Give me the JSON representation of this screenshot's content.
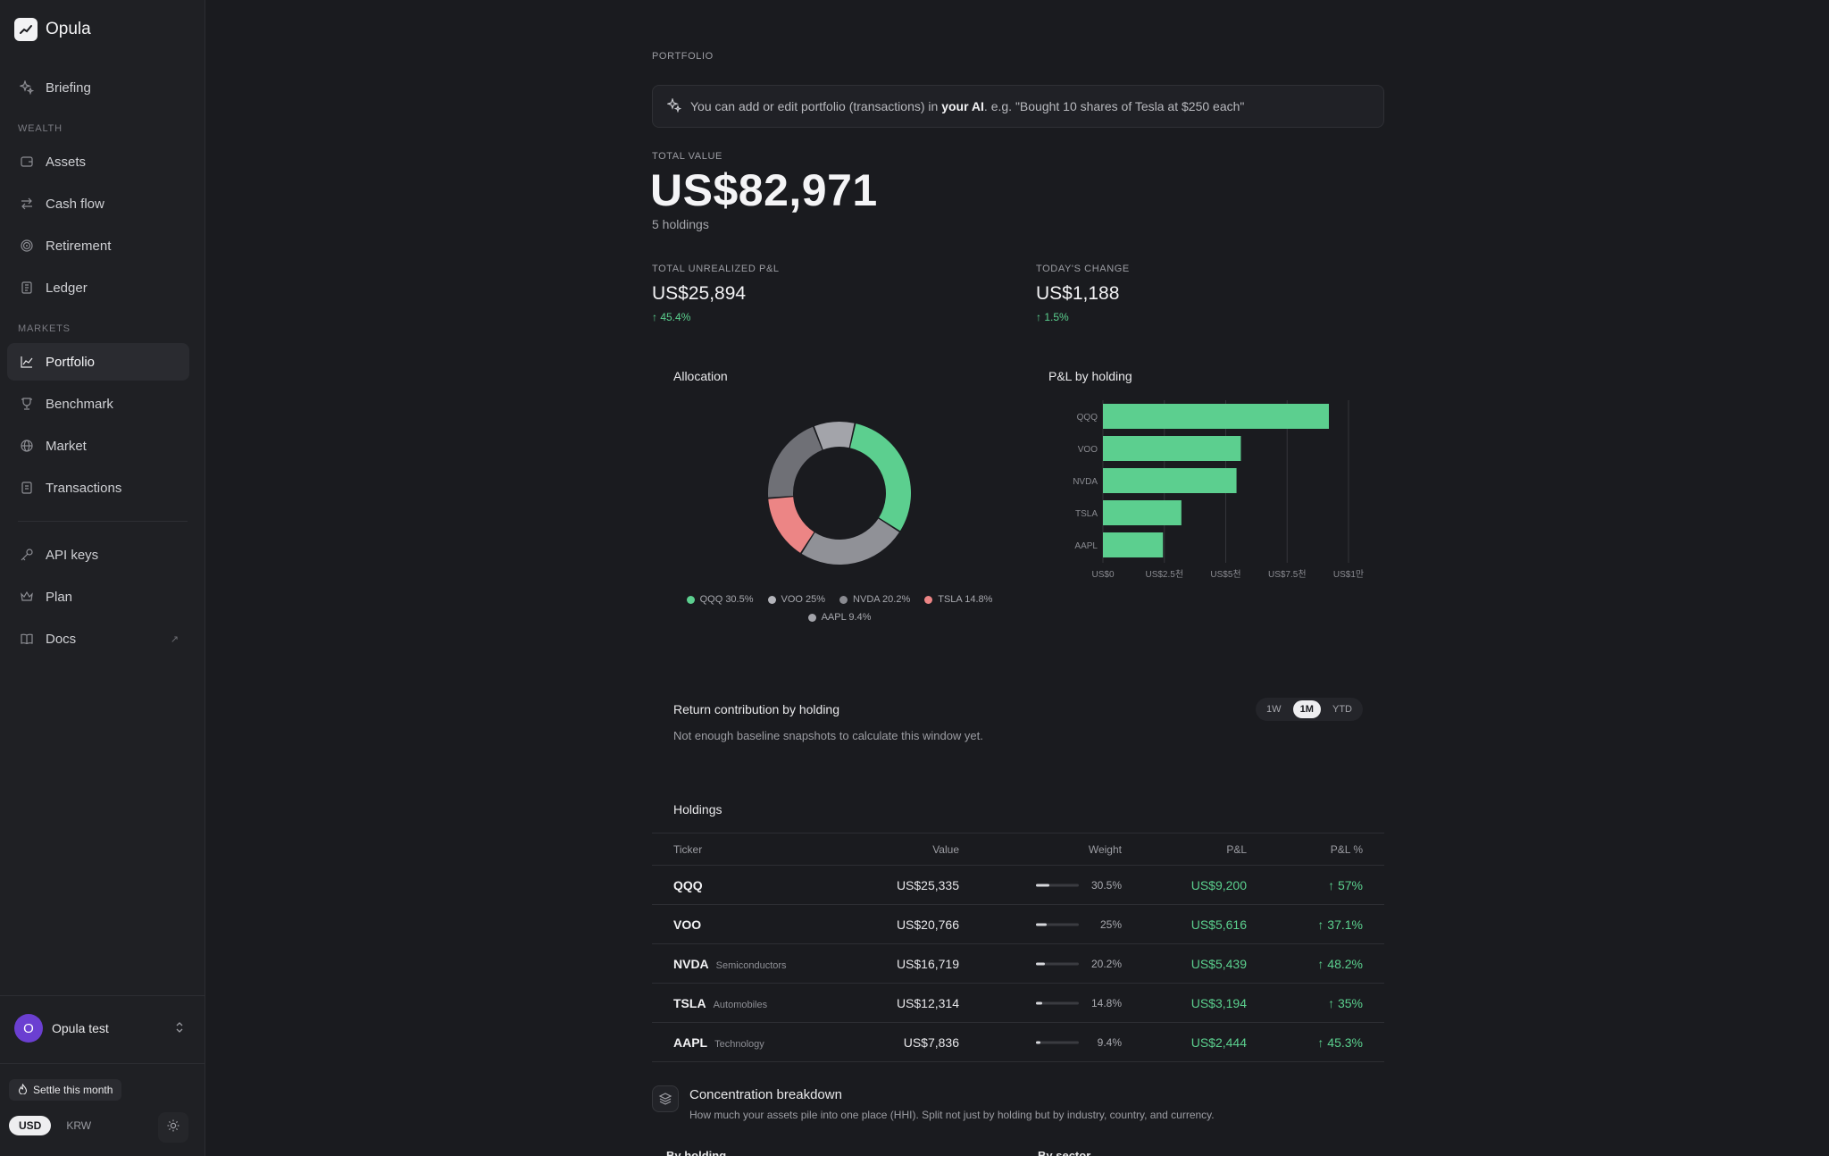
{
  "app": {
    "name": "Opula"
  },
  "sidebar": {
    "briefing": "Briefing",
    "sections": {
      "wealth": "WEALTH",
      "markets": "MARKETS"
    },
    "wealth_items": [
      "Assets",
      "Cash flow",
      "Retirement",
      "Ledger"
    ],
    "markets_items": [
      "Portfolio",
      "Benchmark",
      "Market",
      "Transactions"
    ],
    "other_items": [
      "API keys",
      "Plan",
      "Docs"
    ],
    "docs_external": "↗",
    "user": {
      "initial": "O",
      "name": "Opula test"
    },
    "settle_label": "Settle this month",
    "currency": {
      "usd": "USD",
      "krw": "KRW",
      "selected": "USD"
    }
  },
  "page": {
    "eyebrow": "PORTFOLIO",
    "banner": {
      "prefix": "You can add or edit portfolio (transactions) in ",
      "emphasis": "your AI",
      "suffix": ". e.g. \"Bought 10 shares of Tesla at $250 each\""
    },
    "total_value_label": "TOTAL VALUE",
    "total_value": "US$82,971",
    "holdings_count": "5 holdings",
    "unrealized_label": "TOTAL UNREALIZED P&L",
    "unrealized_value": "US$25,894",
    "unrealized_pct": "↑ 45.4%",
    "today_label": "TODAY'S CHANGE",
    "today_value": "US$1,188",
    "today_pct": "↑ 1.5%"
  },
  "allocation": {
    "title": "Allocation",
    "colors": [
      "#5ccf8f",
      "#909197",
      "#6f7076",
      "#ec8585",
      "#a3a4aa"
    ],
    "legend": [
      "QQQ 30.5%",
      "VOO 25%",
      "NVDA 20.2%",
      "TSLA 14.8%",
      "AAPL 9.4%"
    ]
  },
  "chart_data": {
    "type": "bar",
    "title": "P&L by holding",
    "orientation": "horizontal",
    "categories": [
      "QQQ",
      "VOO",
      "NVDA",
      "TSLA",
      "AAPL"
    ],
    "values": [
      9200,
      5616,
      5439,
      3194,
      2444
    ],
    "xlim": [
      0,
      10000
    ],
    "x_ticks": [
      0,
      2500,
      5000,
      7500,
      10000
    ],
    "x_tick_labels": [
      "US$0",
      "US$2.5천",
      "US$5천",
      "US$7.5천",
      "US$1만"
    ],
    "bar_color": "#5ccf8f",
    "grid": true
  },
  "contribution": {
    "title": "Return contribution by holding",
    "note": "Not enough baseline snapshots to calculate this window yet.",
    "ranges": [
      "1W",
      "1M",
      "YTD"
    ],
    "selected": "1M"
  },
  "holdings": {
    "title": "Holdings",
    "columns": [
      "Ticker",
      "Value",
      "Weight",
      "P&L",
      "P&L %"
    ],
    "rows": [
      {
        "ticker": "QQQ",
        "sector": "",
        "value": "US$25,335",
        "weight": "30.5%",
        "weight_pct": 30.5,
        "pl": "US$9,200",
        "pl_pct": "↑ 57%"
      },
      {
        "ticker": "VOO",
        "sector": "",
        "value": "US$20,766",
        "weight": "25%",
        "weight_pct": 25,
        "pl": "US$5,616",
        "pl_pct": "↑ 37.1%"
      },
      {
        "ticker": "NVDA",
        "sector": "Semiconductors",
        "value": "US$16,719",
        "weight": "20.2%",
        "weight_pct": 20.2,
        "pl": "US$5,439",
        "pl_pct": "↑ 48.2%"
      },
      {
        "ticker": "TSLA",
        "sector": "Automobiles",
        "value": "US$12,314",
        "weight": "14.8%",
        "weight_pct": 14.8,
        "pl": "US$3,194",
        "pl_pct": "↑ 35%"
      },
      {
        "ticker": "AAPL",
        "sector": "Technology",
        "value": "US$7,836",
        "weight": "9.4%",
        "weight_pct": 9.4,
        "pl": "US$2,444",
        "pl_pct": "↑ 45.3%"
      }
    ]
  },
  "concentration": {
    "title": "Concentration breakdown",
    "subtitle": "How much your assets pile into one place (HHI). Split not just by holding but by industry, country, and currency.",
    "sub_tabs": [
      "By holding",
      "By sector"
    ]
  }
}
